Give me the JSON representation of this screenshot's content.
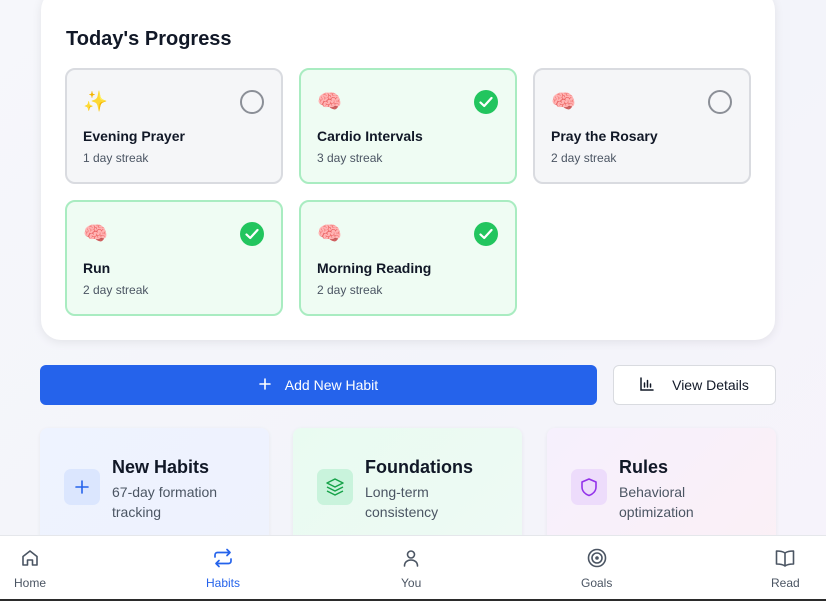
{
  "progress": {
    "title": "Today's Progress",
    "habits": [
      {
        "emoji": "✨",
        "name": "Evening Prayer",
        "streak": "1 day streak",
        "done": false
      },
      {
        "emoji": "🧠",
        "name": "Cardio Intervals",
        "streak": "3 day streak",
        "done": true
      },
      {
        "emoji": "🧠",
        "name": "Pray the Rosary",
        "streak": "2 day streak",
        "done": false
      },
      {
        "emoji": "🧠",
        "name": "Run",
        "streak": "2 day streak",
        "done": true
      },
      {
        "emoji": "🧠",
        "name": "Morning Reading",
        "streak": "2 day streak",
        "done": true
      }
    ]
  },
  "actions": {
    "add_label": "Add New Habit",
    "details_label": "View Details"
  },
  "categories": [
    {
      "title": "New Habits",
      "desc": "67-day formation tracking",
      "icon": "plus-icon"
    },
    {
      "title": "Foundations",
      "desc": "Long-term consistency",
      "icon": "layers-icon"
    },
    {
      "title": "Rules",
      "desc": "Behavioral optimization",
      "icon": "shield-icon"
    }
  ],
  "nav": {
    "items": [
      {
        "label": "Home",
        "icon": "home-icon",
        "active": false
      },
      {
        "label": "Habits",
        "icon": "repeat-icon",
        "active": true
      },
      {
        "label": "You",
        "icon": "user-icon",
        "active": false
      },
      {
        "label": "Goals",
        "icon": "target-icon",
        "active": false
      },
      {
        "label": "Read",
        "icon": "book-icon",
        "active": false
      }
    ]
  },
  "colors": {
    "accent": "#2563eb",
    "success": "#22c55e"
  }
}
